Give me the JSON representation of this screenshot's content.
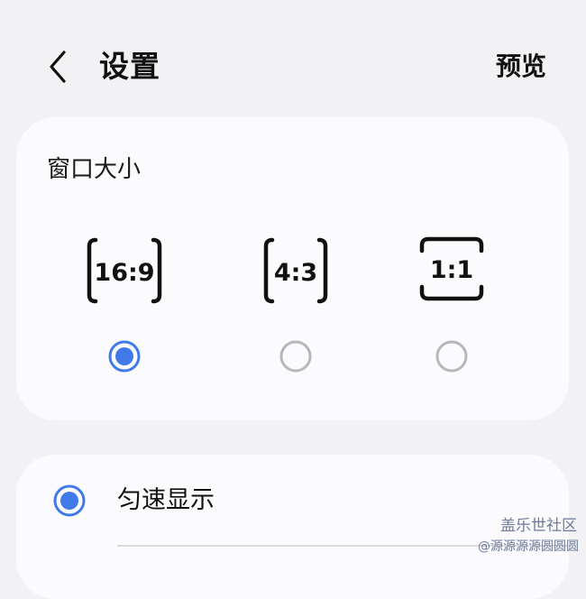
{
  "header": {
    "title": "设置",
    "preview_label": "预览",
    "back_icon": "chevron-left-icon"
  },
  "window_size": {
    "title": "窗口大小",
    "options": [
      {
        "label": "16:9",
        "selected": true
      },
      {
        "label": "4:3",
        "selected": false
      },
      {
        "label": "1:1",
        "selected": false
      }
    ]
  },
  "display_mode": {
    "items": [
      {
        "label": "匀速显示",
        "selected": true
      }
    ]
  },
  "watermark": {
    "brand": "盖乐世社区",
    "source": "@源源源源圆圆圆"
  },
  "colors": {
    "accent": "#3f7ae8",
    "radio_off": "#b7b7ba",
    "background": "#f2f2f4",
    "card": "#fbfbfd"
  }
}
